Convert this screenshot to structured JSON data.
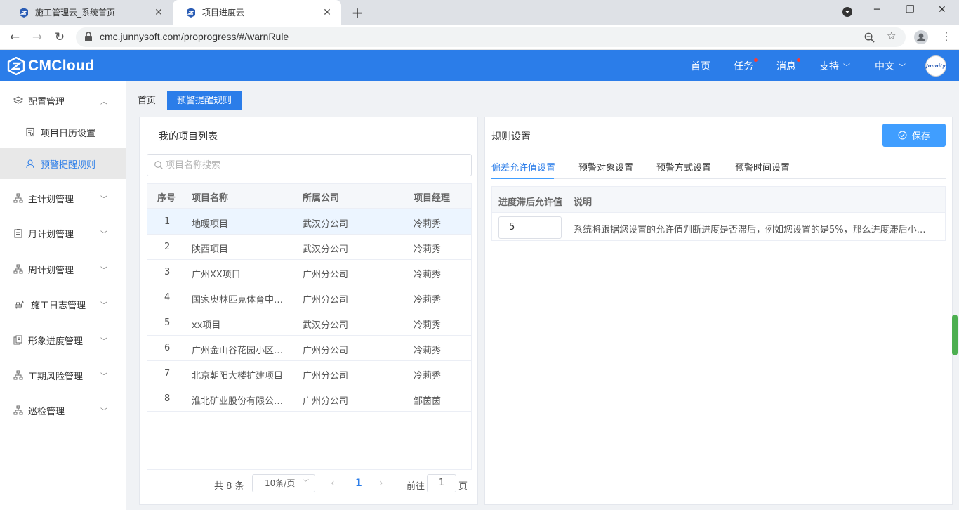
{
  "browser": {
    "tabs": [
      {
        "title": "施工管理云_系统首页",
        "close": "✕"
      },
      {
        "title": "项目进度云",
        "close": "✕"
      }
    ],
    "new_tab": "+",
    "url": "cmc.junnysoft.com/proprogress/#/warnRule",
    "window_controls": {
      "minimize": "─",
      "restore": "❐",
      "close": "✕"
    }
  },
  "header": {
    "logo_text": "CMCloud",
    "nav": [
      {
        "label": "首页",
        "dot": false
      },
      {
        "label": "任务",
        "dot": true
      },
      {
        "label": "消息",
        "dot": true
      },
      {
        "label": "支持",
        "caret": true
      },
      {
        "label": "中文",
        "caret": true
      }
    ],
    "avatar_text": "Junnity",
    "colors": {
      "primary": "#2b7de9",
      "badge": "#ff3b30"
    }
  },
  "sidebar": {
    "items": [
      {
        "label": "配置管理",
        "expanded": true
      },
      {
        "label": "项目日历设置",
        "sub": true
      },
      {
        "label": "预警提醒规则",
        "sub": true,
        "selected": true
      },
      {
        "label": "主计划管理"
      },
      {
        "label": "月计划管理"
      },
      {
        "label": "周计划管理"
      },
      {
        "label": "施工日志管理"
      },
      {
        "label": "形象进度管理"
      },
      {
        "label": "工期风险管理"
      },
      {
        "label": "巡检管理"
      }
    ]
  },
  "breadcrumbs": {
    "home": "首页",
    "active": "预警提醒规则"
  },
  "project_list": {
    "title": "我的项目列表",
    "search_placeholder": "项目名称搜索",
    "columns": [
      "序号",
      "项目名称",
      "所属公司",
      "项目经理"
    ],
    "rows": [
      {
        "no": "1",
        "name": "地暖项目",
        "company": "武汉分公司",
        "manager": "冷莉秀"
      },
      {
        "no": "2",
        "name": "陕西项目",
        "company": "武汉分公司",
        "manager": "冷莉秀"
      },
      {
        "no": "3",
        "name": "广州XX项目",
        "company": "广州分公司",
        "manager": "冷莉秀"
      },
      {
        "no": "4",
        "name": "国家奥林匹克体育中心...",
        "company": "广州分公司",
        "manager": "冷莉秀"
      },
      {
        "no": "5",
        "name": "xx项目",
        "company": "武汉分公司",
        "manager": "冷莉秀"
      },
      {
        "no": "6",
        "name": "广州金山谷花园小区扩...",
        "company": "广州分公司",
        "manager": "冷莉秀"
      },
      {
        "no": "7",
        "name": "北京朝阳大楼扩建项目",
        "company": "广州分公司",
        "manager": "冷莉秀"
      },
      {
        "no": "8",
        "name": "淮北矿业股份有限公司...",
        "company": "广州分公司",
        "manager": "邹茵茵"
      }
    ],
    "selected_row": 1,
    "pagination": {
      "total": "共 8 条",
      "page_size": "10条/页",
      "prev": "‹",
      "current": "1",
      "next": "›",
      "goto_label": "前往",
      "goto_value": "1",
      "page_suffix": "页"
    }
  },
  "rules": {
    "title": "规则设置",
    "save_label": "保存",
    "tabs": [
      "偏差允许值设置",
      "预警对象设置",
      "预警方式设置",
      "预警时间设置"
    ],
    "active_tab": 0,
    "columns": [
      "进度滞后允许值",
      "说明"
    ],
    "tolerance_value": "5",
    "description": "系统将跟据您设置的允许值判断进度是否滞后，例如您设置的是5%，那么进度滞后小于等..."
  }
}
